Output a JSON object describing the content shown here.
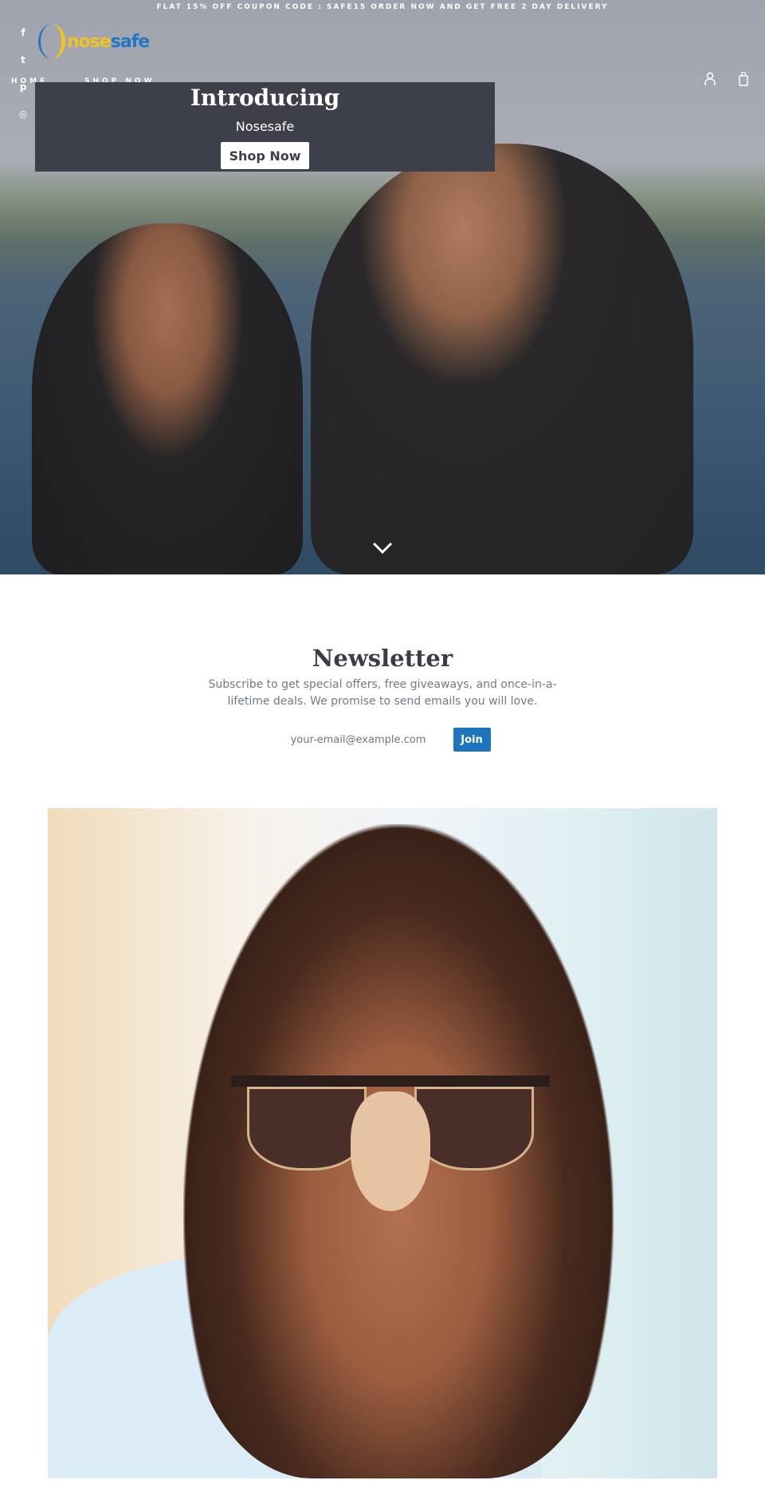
{
  "announcement": "FLAT 15% OFF COUPON CODE : SAFE15 ORDER NOW AND GET FREE 2 DAY DELIVERY",
  "social": [
    {
      "icon": "facebook-icon",
      "glyph": "f"
    },
    {
      "icon": "twitter-icon",
      "glyph": "t"
    },
    {
      "icon": "pinterest-icon",
      "glyph": "p"
    },
    {
      "icon": "instagram-icon",
      "glyph": "◎"
    }
  ],
  "logo": {
    "part1": "nose",
    "part2": "safe",
    "colors": {
      "nose": "#f4c21f",
      "safe": "#1f78c1"
    }
  },
  "nav": {
    "items": [
      "HOME",
      "SHOP NOW"
    ]
  },
  "header_icons": [
    "account-icon",
    "cart-icon"
  ],
  "hero": {
    "title": "Introducing",
    "subtitle": "Nosesafe",
    "button": "Shop Now",
    "scroll_icon": "chevron-down-icon"
  },
  "newsletter": {
    "title": "Newsletter",
    "description": "Subscribe to get special offers, free giveaways, and once-in-a-lifetime deals. We promise to send emails you will love.",
    "placeholder": "your-email@example.com",
    "button": "Join",
    "accent": "#1d76bd"
  }
}
